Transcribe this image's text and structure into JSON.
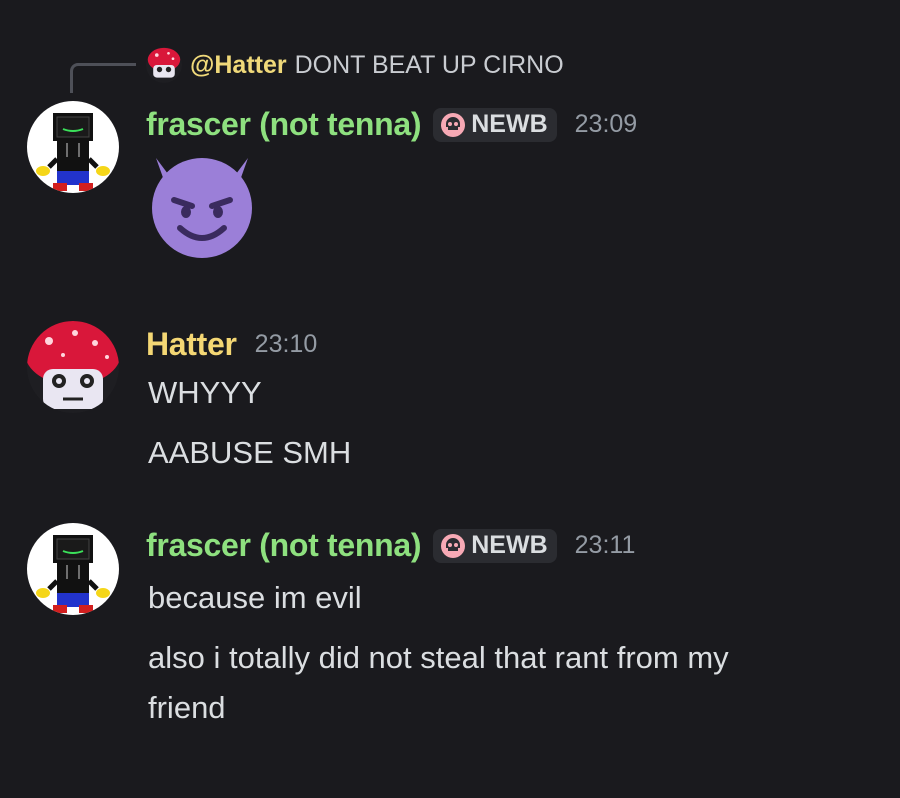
{
  "reply": {
    "author": "@Hatter",
    "text": "DONT BEAT UP CIRNO"
  },
  "messages": [
    {
      "username": "frascer (not tenna)",
      "tag": "NEWB",
      "time": "23:09",
      "emoji": "smiling-imp-emoji"
    },
    {
      "username": "Hatter",
      "time": "23:10",
      "lines": [
        "WHYYY",
        "AABUSE SMH"
      ]
    },
    {
      "username": "frascer (not tenna)",
      "tag": "NEWB",
      "time": "23:11",
      "lines": [
        "because im evil",
        "also i totally did not steal that rant from my",
        "friend"
      ]
    }
  ],
  "colors": {
    "background": "#1a1a1e",
    "frascer_name": "#8ee07f",
    "hatter_name": "#f4d774",
    "timestamp": "#949ba4",
    "tag_bg": "#2b2c31"
  }
}
